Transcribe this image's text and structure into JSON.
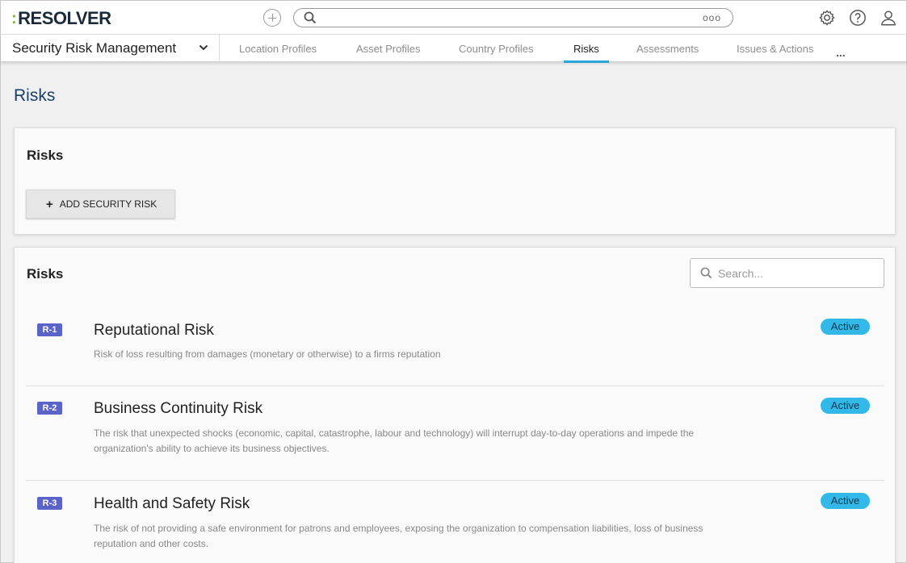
{
  "brand": {
    "name": "RESOLVER",
    "accent": "#7cb342"
  },
  "topbar": {
    "add_icon": "plus-circle-icon",
    "search_icon": "search-icon",
    "more_dots": "ooo",
    "icons": [
      "gear-icon",
      "help-icon",
      "user-icon"
    ]
  },
  "nav": {
    "app_name": "Security Risk Management",
    "tabs": [
      {
        "label": "Location Profiles",
        "active": false
      },
      {
        "label": "Asset Profiles",
        "active": false
      },
      {
        "label": "Country Profiles",
        "active": false
      },
      {
        "label": "Risks",
        "active": true
      },
      {
        "label": "Assessments",
        "active": false
      },
      {
        "label": "Issues & Actions",
        "active": false
      }
    ],
    "more": "..."
  },
  "page": {
    "title": "Risks"
  },
  "card_add": {
    "title": "Risks",
    "button_label": "ADD SECURITY RISK"
  },
  "card_list": {
    "title": "Risks",
    "search_placeholder": "Search...",
    "items": [
      {
        "id": "R-1",
        "name": "Reputational Risk",
        "description": "Risk of loss resulting from damages (monetary or otherwise) to a firms reputation",
        "status": "Active"
      },
      {
        "id": "R-2",
        "name": "Business Continuity Risk",
        "description": "The risk that unexpected shocks (economic, capital, catastrophe, labour and technology) will interrupt day-to-day operations and impede the organization's ability to achieve its business objectives.",
        "status": "Active"
      },
      {
        "id": "R-3",
        "name": "Health and Safety Risk",
        "description": "The risk of not providing a safe environment for patrons and employees, exposing the organization to compensation liabilities, loss of business reputation and other costs.",
        "status": "Active"
      }
    ]
  },
  "colors": {
    "tab_underline": "#2aa5d8",
    "id_badge": "#5a64c8",
    "status_badge": "#33b9e8",
    "title": "#1a3f6e"
  }
}
